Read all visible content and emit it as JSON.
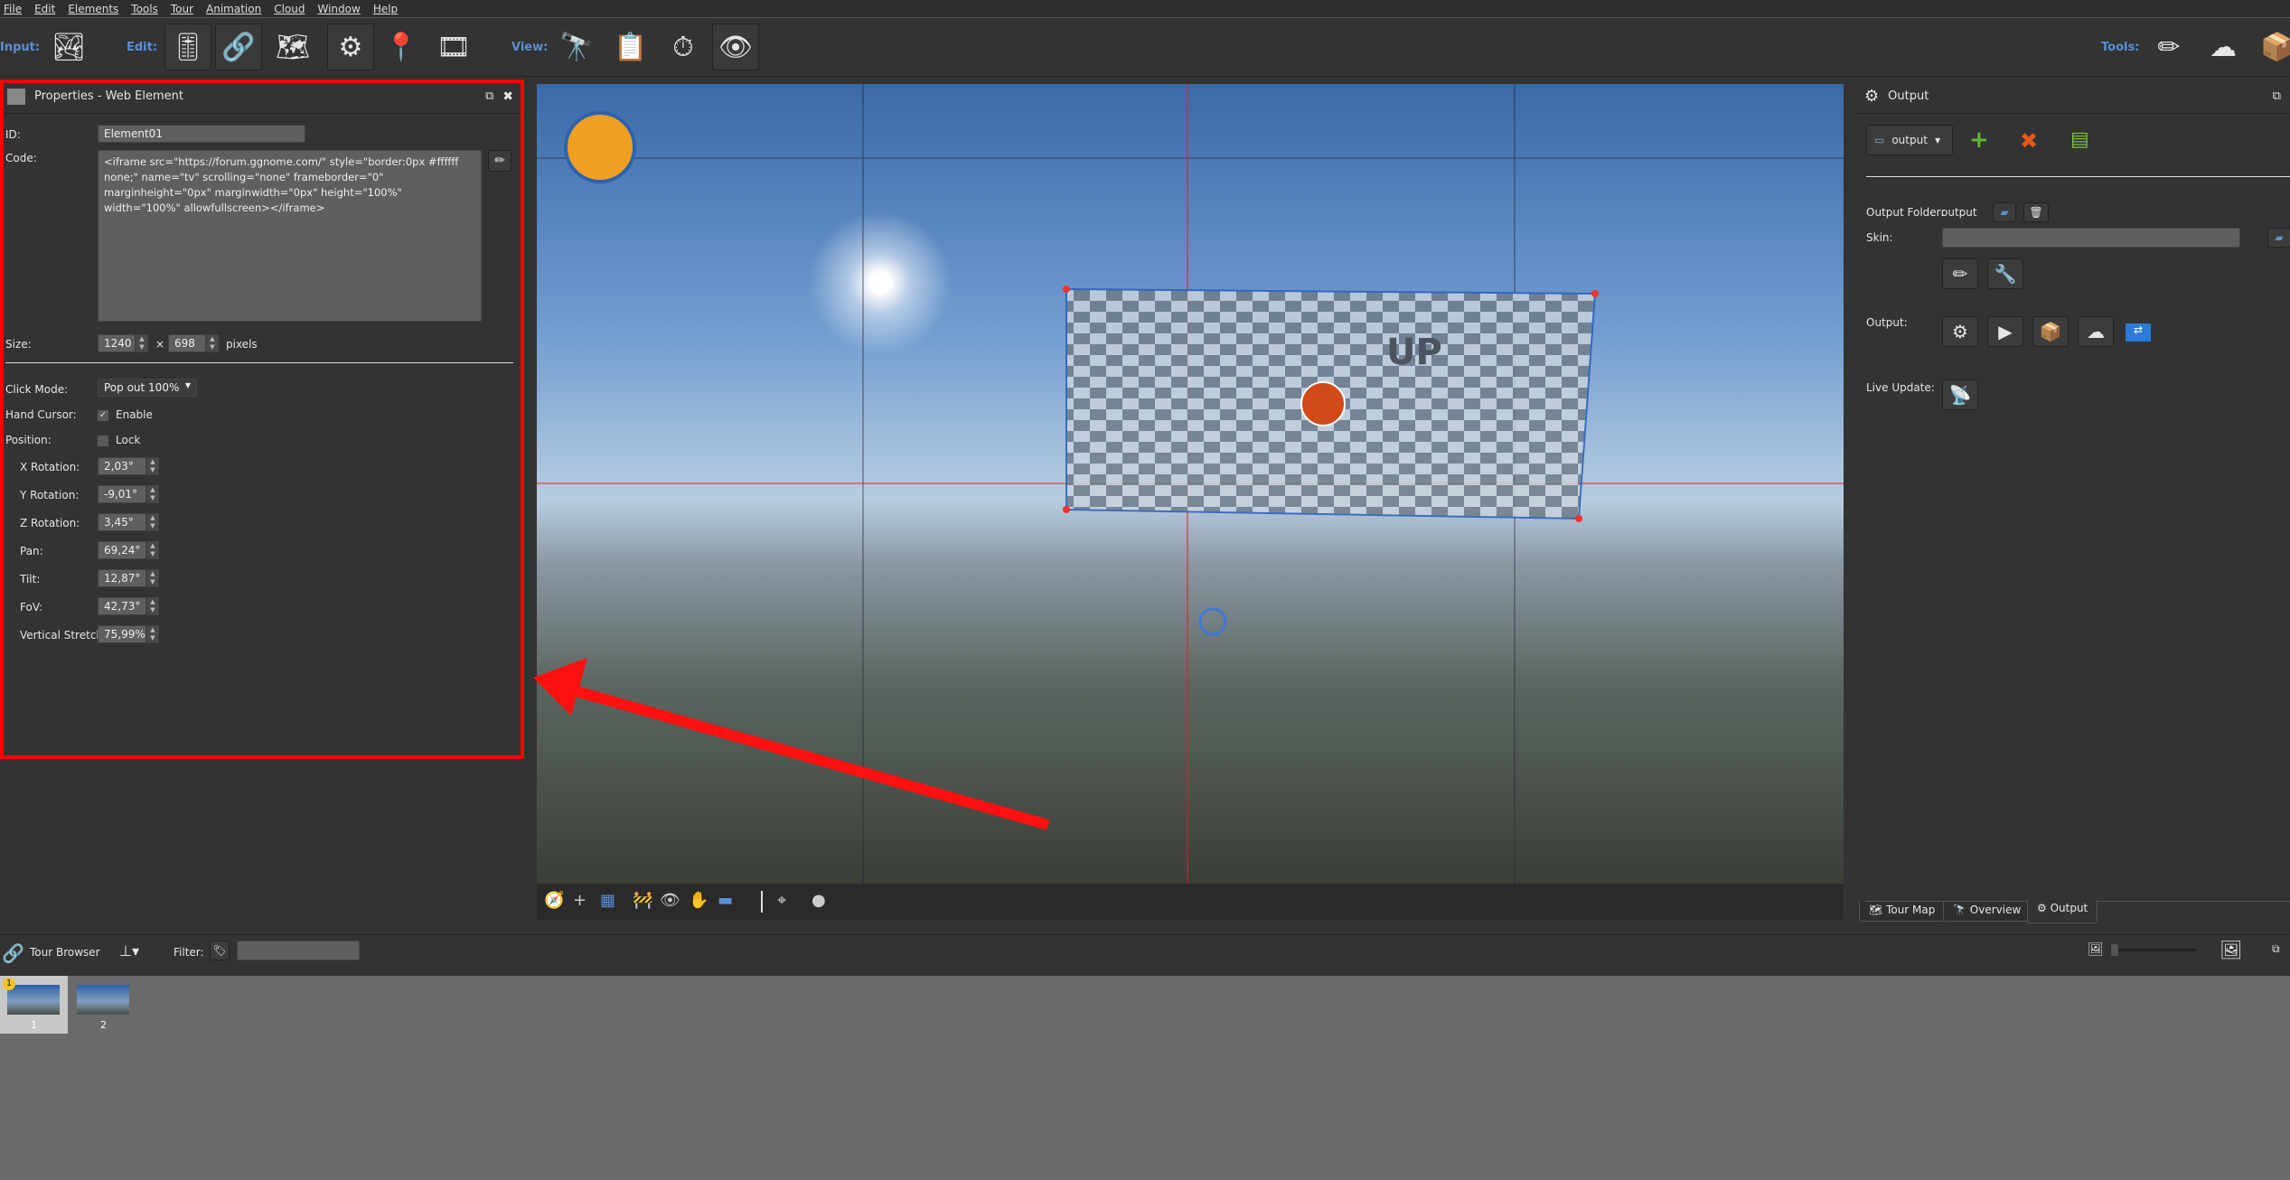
{
  "menu": [
    "File",
    "Edit",
    "Elements",
    "Tools",
    "Tour",
    "Animation",
    "Cloud",
    "Window",
    "Help"
  ],
  "toolbar": {
    "input_label": "Input:",
    "edit_label": "Edit:",
    "view_label": "View:",
    "tools_label": "Tools:"
  },
  "properties": {
    "title": "Properties - Web Element",
    "id_label": "ID:",
    "id_value": "Element01",
    "code_label": "Code:",
    "code_value": "<iframe src=\"https://forum.ggnome.com/\" style=\"border:0px #ffffff none;\" name=\"tv\" scrolling=\"none\" frameborder=\"0\" marginheight=\"0px\" marginwidth=\"0px\" height=\"100%\" width=\"100%\" allowfullscreen></iframe>",
    "size_label": "Size:",
    "width": "1240",
    "height": "698",
    "times": "×",
    "units": "pixels",
    "click_mode_label": "Click Mode:",
    "click_mode_value": "Pop out 100%",
    "hand_cursor_label": "Hand Cursor:",
    "hand_cursor_option": "Enable",
    "hand_cursor_checked": true,
    "position_label": "Position:",
    "position_option": "Lock",
    "position_checked": false,
    "params": [
      {
        "label": "X Rotation:",
        "value": "2,03°"
      },
      {
        "label": "Y Rotation:",
        "value": "-9,01°"
      },
      {
        "label": "Z Rotation:",
        "value": "3,45°"
      },
      {
        "label": "Pan:",
        "value": "69,24°"
      },
      {
        "label": "Tilt:",
        "value": "12,87°"
      },
      {
        "label": "FoV:",
        "value": "42,73°"
      },
      {
        "label": "Vertical Stretch:",
        "value": "75,99%"
      }
    ]
  },
  "output": {
    "title": "Output",
    "selector": "output",
    "folder_label": "Output Folder:",
    "folder_value": "output",
    "skin_label": "Skin:",
    "skin_value": "",
    "output_label": "Output:",
    "live_update_label": "Live Update:",
    "tabs": [
      "Tour Map",
      "Overview",
      "Output"
    ],
    "active_tab": "Output"
  },
  "tour_browser": {
    "title": "Tour Browser",
    "filter_label": "Filter:",
    "filter_value": "",
    "thumbnails": [
      {
        "label": "1",
        "badge": "1",
        "selected": true
      },
      {
        "label": "2",
        "selected": false
      }
    ]
  },
  "colors": {
    "highlight": "#ff0000",
    "accent": "#5b8fd6"
  }
}
